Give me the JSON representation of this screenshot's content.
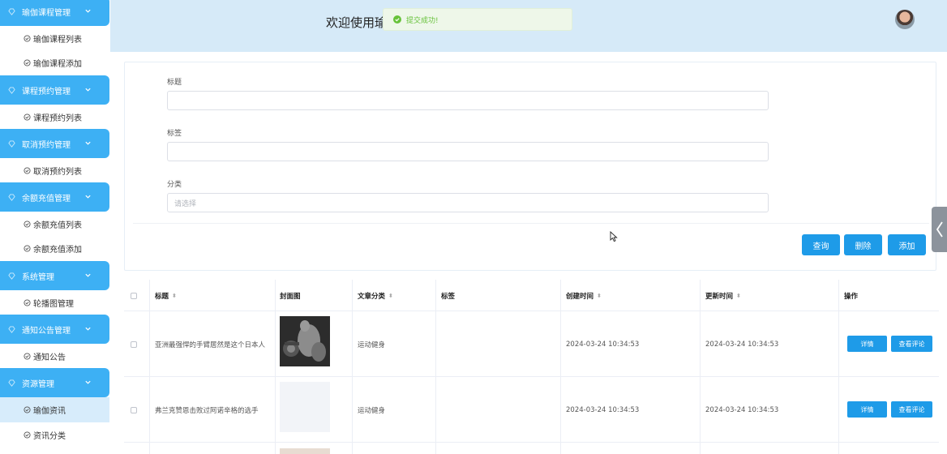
{
  "sidebar": {
    "groups": [
      {
        "label": "瑜伽课程管理",
        "items": [
          "瑜伽课程列表",
          "瑜伽课程添加"
        ]
      },
      {
        "label": "课程预约管理",
        "items": [
          "课程预约列表"
        ]
      },
      {
        "label": "取消预约管理",
        "items": [
          "取消预约列表"
        ]
      },
      {
        "label": "余额充值管理",
        "items": [
          "余额充值列表",
          "余额充值添加"
        ]
      },
      {
        "label": "系统管理",
        "items": [
          "轮播图管理"
        ]
      },
      {
        "label": "通知公告管理",
        "items": [
          "通知公告"
        ]
      },
      {
        "label": "资源管理",
        "items": [
          "瑜伽资讯",
          "资讯分类"
        ]
      }
    ],
    "active_item": "瑜伽资讯"
  },
  "header": {
    "title": "欢迎使用瑜"
  },
  "toast": {
    "message": "提交成功!"
  },
  "form": {
    "fields": [
      {
        "label": "标题",
        "value": "",
        "placeholder": ""
      },
      {
        "label": "标签",
        "value": "",
        "placeholder": ""
      },
      {
        "label": "分类",
        "value": "",
        "placeholder": "请选择"
      }
    ],
    "buttons": {
      "query": "查询",
      "delete": "删除",
      "add": "添加"
    }
  },
  "table": {
    "headers": {
      "title": "标题",
      "cover": "封面图",
      "category": "文章分类",
      "tags": "标签",
      "created": "创建时间",
      "updated": "更新时间",
      "actions": "操作"
    },
    "rows": [
      {
        "title": "亚洲最强悍的手臂居然是这个日本人",
        "category": "运动健身",
        "tags": "",
        "created": "2024-03-24 10:34:53",
        "updated": "2024-03-24 10:34:53",
        "detail": "详情",
        "comments": "查看评论"
      },
      {
        "title": "弗兰克赞恩击败过阿诺辛格的选手",
        "category": "运动健身",
        "tags": "",
        "created": "2024-03-24 10:34:53",
        "updated": "2024-03-24 10:34:53",
        "detail": "详情",
        "comments": "查看评论"
      }
    ]
  },
  "colors": {
    "accent": "#3db0f4",
    "header_bg": "#d6eaf8",
    "button": "#1e9be8",
    "success": "#67c23a"
  }
}
